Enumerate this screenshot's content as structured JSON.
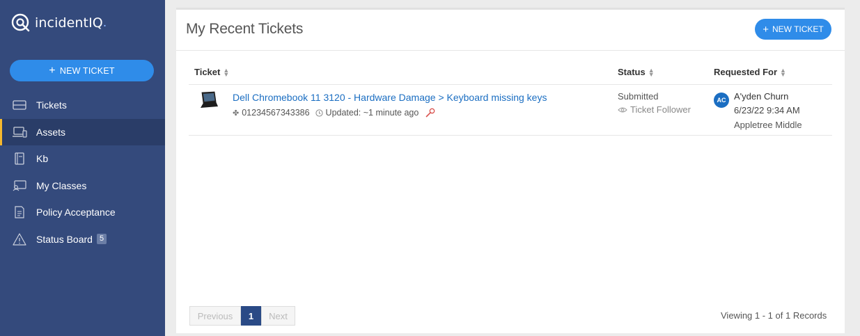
{
  "app": {
    "logo_text": "incidentIQ",
    "logo_suffix": "."
  },
  "sidebar": {
    "new_ticket_label": "NEW TICKET",
    "items": [
      {
        "label": "Tickets",
        "icon": "tickets-icon"
      },
      {
        "label": "Assets",
        "icon": "assets-icon",
        "active": true
      },
      {
        "label": "Kb",
        "icon": "kb-book-icon"
      },
      {
        "label": "My Classes",
        "icon": "classes-icon"
      },
      {
        "label": "Policy Acceptance",
        "icon": "policy-document-icon"
      },
      {
        "label": "Status Board",
        "icon": "warning-triangle-icon",
        "badge": "5"
      }
    ]
  },
  "main": {
    "title": "My Recent Tickets",
    "new_ticket_label": "NEW TICKET",
    "columns": [
      "Ticket",
      "Status",
      "Requested For"
    ],
    "ticket": {
      "title": "Dell Chromebook 11 3120 - Hardware Damage > Keyboard missing keys",
      "asset_tag": "01234567343386",
      "updated": "Updated: ~1 minute ago",
      "status": "Submitted",
      "follower": "Ticket Follower",
      "requester_initials": "AC",
      "requester_name": "A'yden Churn",
      "requested_date": "6/23/22 9:34 AM",
      "location": "Appletree Middle"
    },
    "pagination": {
      "previous": "Previous",
      "current": "1",
      "next": "Next",
      "viewing": "Viewing 1 - 1 of 1 Records"
    }
  },
  "colors": {
    "sidebar_bg": "#344a7c",
    "accent_blue": "#2f8ce9",
    "active_marker": "#f5b82e",
    "link": "#1b6ec2"
  }
}
